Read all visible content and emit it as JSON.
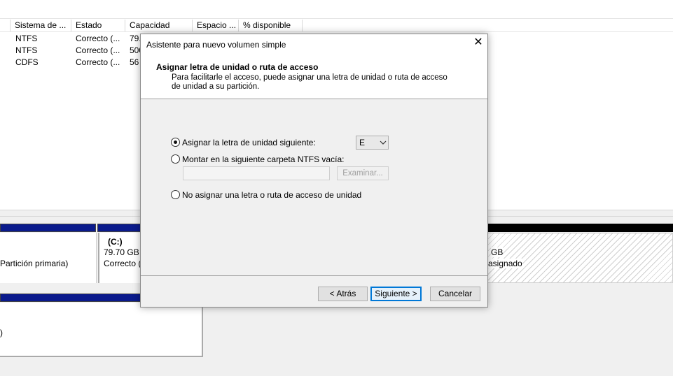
{
  "volume_list": {
    "columns": [
      "Sistema de ...",
      "Estado",
      "Capacidad",
      "Espacio ...",
      "% disponible"
    ],
    "rows": [
      {
        "fs": "NTFS",
        "status": "Correcto (...",
        "capacity": "79."
      },
      {
        "fs": "NTFS",
        "status": "Correcto (...",
        "capacity": "500"
      },
      {
        "fs": "CDFS",
        "status": "Correcto (...",
        "capacity": "56"
      }
    ]
  },
  "disk_view": {
    "left_partition_type": "Partición primaria)",
    "c_volume": {
      "name": "(C:)",
      "size": "79.70 GB N",
      "status": "Correcto ("
    },
    "unallocated": {
      "size": "GB",
      "status": "asignado"
    },
    "lower_fragment": ")"
  },
  "dialog": {
    "title": "Asistente para nuevo volumen simple",
    "close_glyph": "✕",
    "heading": "Asignar letra de unidad o ruta de acceso",
    "description": "Para facilitarle el acceso, puede asignar una letra de unidad o ruta de acceso de unidad a su partición.",
    "option_letter": "Asignar la letra de unidad siguiente:",
    "drive_letter": "E",
    "option_folder": "Montar en la siguiente carpeta NTFS vacía:",
    "browse_label": "Examinar...",
    "option_none": "No asignar una letra o ruta de acceso de unidad",
    "selected_option": "option_letter",
    "back_label": "< Atrás",
    "next_label": "Siguiente >",
    "cancel_label": "Cancelar"
  },
  "colors": {
    "partition_bar": "#0a1a8c",
    "accent": "#0078d7"
  }
}
